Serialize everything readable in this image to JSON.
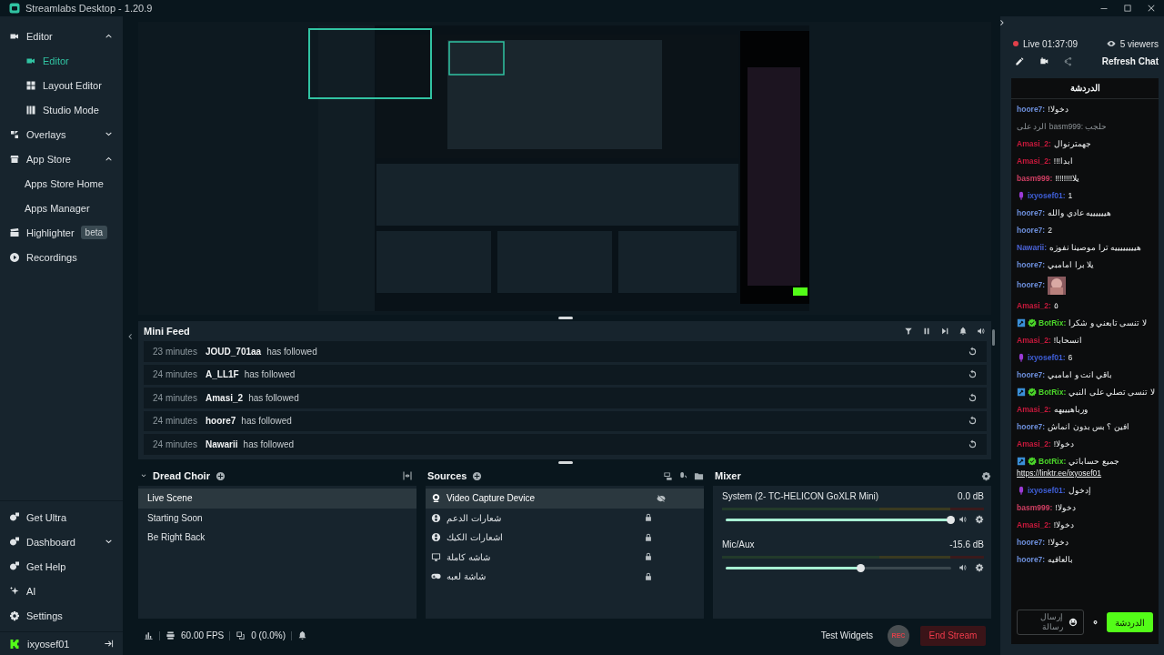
{
  "window": {
    "title": "Streamlabs Desktop - 1.20.9"
  },
  "sidebar": {
    "items": [
      {
        "label": "Editor",
        "selected": false,
        "expanded": true,
        "children": [
          {
            "label": "Editor",
            "selected": true
          },
          {
            "label": "Layout Editor",
            "selected": false
          },
          {
            "label": "Studio Mode",
            "selected": false
          }
        ]
      },
      {
        "label": "Overlays",
        "selected": false,
        "expanded": false
      },
      {
        "label": "App Store",
        "selected": false,
        "expanded": true,
        "children": [
          {
            "label": "Apps Store Home",
            "selected": false
          },
          {
            "label": "Apps Manager",
            "selected": false
          }
        ]
      },
      {
        "label": "Highlighter",
        "selected": false,
        "badge": "beta"
      },
      {
        "label": "Recordings",
        "selected": false
      }
    ],
    "bottom_items": [
      {
        "label": "Get Ultra",
        "selected": false
      },
      {
        "label": "Dashboard",
        "selected": false,
        "expanded": false
      },
      {
        "label": "Get Help",
        "selected": false
      },
      {
        "label": "AI",
        "selected": false
      },
      {
        "label": "Settings",
        "selected": false
      }
    ],
    "account": {
      "name": "ixyosef01"
    }
  },
  "mini_feed": {
    "title": "Mini Feed",
    "events": [
      {
        "time": "23 minutes",
        "user": "JOUD_701aa",
        "action": "has followed"
      },
      {
        "time": "24 minutes",
        "user": "A_LL1F",
        "action": "has followed"
      },
      {
        "time": "24 minutes",
        "user": "Amasi_2",
        "action": "has followed"
      },
      {
        "time": "24 minutes",
        "user": "hoore7",
        "action": "has followed"
      },
      {
        "time": "24 minutes",
        "user": "Nawarii",
        "action": "has followed"
      }
    ]
  },
  "scenes": {
    "title": "Dread Choir",
    "items": [
      {
        "label": "Live Scene",
        "selected": true
      },
      {
        "label": "Starting Soon",
        "selected": false
      },
      {
        "label": "Be Right Back",
        "selected": false
      }
    ]
  },
  "sources": {
    "title": "Sources",
    "items": [
      {
        "label": "Video Capture Device",
        "kind": "webcam",
        "selected": true,
        "hidden": true,
        "locked": false
      },
      {
        "label": "شعارات الدعم",
        "kind": "browser",
        "selected": false,
        "hidden": false,
        "locked": true
      },
      {
        "label": "اشعارات الكيك",
        "kind": "browser",
        "selected": false,
        "hidden": false,
        "locked": true
      },
      {
        "label": "شاشه كاملة",
        "kind": "display",
        "selected": false,
        "hidden": false,
        "locked": true
      },
      {
        "label": "شاشة لعبه",
        "kind": "game",
        "selected": false,
        "hidden": false,
        "locked": true
      }
    ]
  },
  "mixer": {
    "title": "Mixer",
    "channels": [
      {
        "name": "System (2- TC-HELICON GoXLR Mini)",
        "reading": "0.0 dB",
        "level": 1.0
      },
      {
        "name": "Mic/Aux",
        "reading": "-15.6 dB",
        "level": 0.6
      }
    ]
  },
  "status_bar": {
    "fps": "60.00 FPS",
    "dropped": "0 (0.0%)",
    "test_widgets": "Test Widgets",
    "rec": "REC",
    "end_stream": "End Stream"
  },
  "chat": {
    "live": "Live 01:37:09",
    "viewers": "5 viewers",
    "refresh": "Refresh Chat",
    "title": "الدردشة",
    "placeholder": "إرسال رسالة",
    "send": "الدردشة",
    "messages": [
      {
        "kind": "text",
        "user": "hoore7:",
        "color": "#6d8fdc",
        "mic": false,
        "mod": false,
        "verified": false,
        "text": "دخولا!"
      },
      {
        "kind": "reply",
        "text": "الرد على basm999: حلجب"
      },
      {
        "kind": "text",
        "user": "Amasi_2:",
        "color": "#c8193c",
        "mic": false,
        "mod": false,
        "verified": false,
        "text": "جهمترنوال"
      },
      {
        "kind": "text",
        "user": "Amasi_2:",
        "color": "#c8193c",
        "mic": false,
        "mod": false,
        "verified": false,
        "text": "ابدا!!!"
      },
      {
        "kind": "text",
        "user": "basm999:",
        "color": "#d13f63",
        "mic": false,
        "mod": false,
        "verified": false,
        "text": "يلا!!!!!!!!"
      },
      {
        "kind": "text",
        "user": "ixyosef01:",
        "color": "#3f5fd8",
        "mic": true,
        "mod": false,
        "verified": false,
        "text": "1"
      },
      {
        "kind": "text",
        "user": "hoore7:",
        "color": "#6d8fdc",
        "mic": false,
        "mod": false,
        "verified": false,
        "text": "هييييييه عادي والله"
      },
      {
        "kind": "text",
        "user": "hoore7:",
        "color": "#6d8fdc",
        "mic": false,
        "mod": false,
        "verified": false,
        "text": "2"
      },
      {
        "kind": "text",
        "user": "Nawarii:",
        "color": "#4b63d8",
        "mic": false,
        "mod": false,
        "verified": false,
        "text": "هييييييييه ترا موصينا نفوزه"
      },
      {
        "kind": "text",
        "user": "hoore7:",
        "color": "#6d8fdc",
        "mic": false,
        "mod": false,
        "verified": false,
        "text": "يلا برا امامبي"
      },
      {
        "user": "hoore7:",
        "color": "#6d8fdc",
        "mic": false,
        "mod": false,
        "verified": false
      },
      {
        "kind": "text",
        "user": "Amasi_2:",
        "color": "#c8193c",
        "mic": false,
        "mod": false,
        "verified": false,
        "text": "٥"
      },
      {
        "kind": "text",
        "user": "BotRix:",
        "color": "#4bd62a",
        "mic": false,
        "mod": true,
        "verified": true,
        "text": "لا تنسى تابعني و شكرا"
      },
      {
        "kind": "text",
        "user": "Amasi_2:",
        "color": "#c8193c",
        "mic": false,
        "mod": false,
        "verified": false,
        "text": "انسحابا!"
      },
      {
        "kind": "text",
        "user": "ixyosef01:",
        "color": "#3f5fd8",
        "mic": true,
        "mod": false,
        "verified": false,
        "text": "6"
      },
      {
        "kind": "text",
        "user": "hoore7:",
        "color": "#6d8fdc",
        "mic": false,
        "mod": false,
        "verified": false,
        "text": "باقي انت و امامبي"
      },
      {
        "kind": "text",
        "user": "BotRix:",
        "color": "#4bd62a",
        "mic": false,
        "mod": true,
        "verified": true,
        "text": "لا تنسى تصلي على النبي"
      },
      {
        "kind": "text",
        "user": "Amasi_2:",
        "color": "#c8193c",
        "mic": false,
        "mod": false,
        "verified": false,
        "text": "ورباهيييهه"
      },
      {
        "kind": "text",
        "user": "hoore7:",
        "color": "#6d8fdc",
        "mic": false,
        "mod": false,
        "verified": false,
        "text": "افين ؟ بس بدون انماش"
      },
      {
        "kind": "text",
        "user": "Amasi_2:",
        "color": "#c8193c",
        "mic": false,
        "mod": false,
        "verified": false,
        "text": "دخولا!"
      },
      {
        "kind": "text",
        "user": "BotRix:",
        "color": "#4bd62a",
        "mic": false,
        "mod": true,
        "verified": true,
        "text": "جميع حساباتي",
        "link": "https://linktr.ee/ixyosef01"
      },
      {
        "kind": "text",
        "user": "ixyosef01:",
        "color": "#3f5fd8",
        "mic": true,
        "mod": false,
        "verified": false,
        "text": "إدخول"
      },
      {
        "kind": "text",
        "user": "basm999:",
        "color": "#d13f63",
        "mic": false,
        "mod": false,
        "verified": false,
        "text": "دخولا!"
      },
      {
        "kind": "text",
        "user": "Amasi_2:",
        "color": "#c8193c",
        "mic": false,
        "mod": false,
        "verified": false,
        "text": "دخولا!"
      },
      {
        "kind": "text",
        "user": "hoore7:",
        "color": "#6d8fdc",
        "mic": false,
        "mod": false,
        "verified": false,
        "text": "دخولا!"
      },
      {
        "kind": "text",
        "user": "hoore7:",
        "color": "#6d8fdc",
        "mic": false,
        "mod": false,
        "verified": false,
        "text": "بالعافيه"
      }
    ]
  }
}
